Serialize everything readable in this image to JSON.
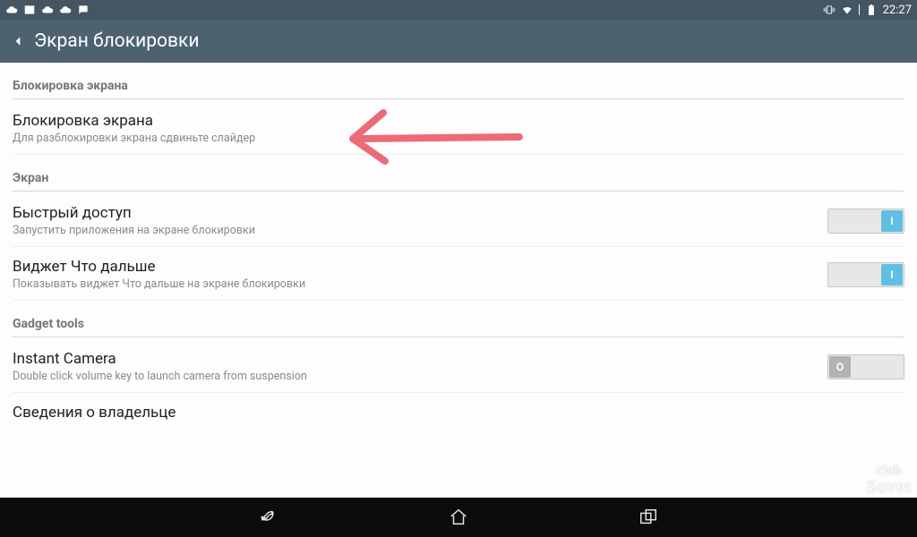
{
  "status": {
    "time": "22:27"
  },
  "header": {
    "title": "Экран блокировки"
  },
  "sections": {
    "s0": {
      "label": "Блокировка экрана"
    },
    "s1": {
      "label": "Экран"
    },
    "s2": {
      "label": "Gadget tools"
    }
  },
  "rows": {
    "lock": {
      "title": "Блокировка экрана",
      "subtitle": "Для разблокировки экрана сдвиньте слайдер"
    },
    "quick": {
      "title": "Быстрый доступ",
      "subtitle": "Запустить приложения на экране блокировки",
      "toggle": "I",
      "on": true
    },
    "widget": {
      "title": "Виджет Что дальше",
      "subtitle": "Показывать виджет Что дальше на экране блокировки",
      "toggle": "I",
      "on": true
    },
    "camera": {
      "title": "Instant Camera",
      "subtitle": "Double click volume key to launch camera from suspension",
      "toggle": "O",
      "on": false
    },
    "owner": {
      "title": "Сведения о владельце"
    }
  },
  "watermark": {
    "line1": "club",
    "line2": "Sovet"
  }
}
